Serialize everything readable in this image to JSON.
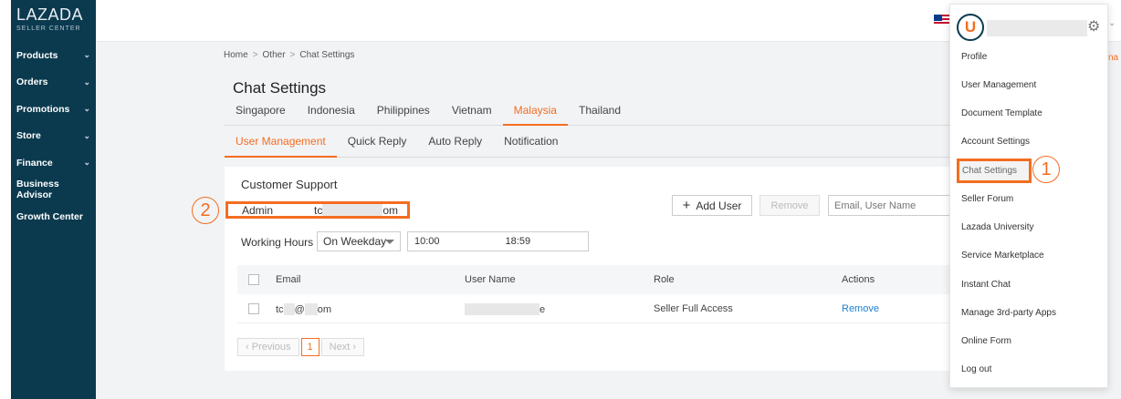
{
  "sidebar": {
    "brand": "LAZADA",
    "brand_sub": "SELLER CENTER",
    "items": [
      {
        "label": "Products",
        "chevron": "⌄"
      },
      {
        "label": "Orders",
        "chevron": "⌄"
      },
      {
        "label": "Promotions",
        "chevron": "⌄"
      },
      {
        "label": "Store",
        "chevron": "⌄"
      },
      {
        "label": "Finance",
        "chevron": "⌄"
      },
      {
        "label": "Business Advisor",
        "chevron": ""
      },
      {
        "label": "Growth Center",
        "chevron": ""
      }
    ]
  },
  "breadcrumb": {
    "home": "Home",
    "sep1": ">",
    "other": "Other",
    "sep2": ">",
    "current": "Chat Settings"
  },
  "page_title": "Chat Settings",
  "country_tabs": [
    "Singapore",
    "Indonesia",
    "Philippines",
    "Vietnam",
    "Malaysia",
    "Thailand"
  ],
  "country_active": "Malaysia",
  "sub_tabs": [
    "User Management",
    "Quick Reply",
    "Auto Reply",
    "Notification"
  ],
  "sub_active": "User Management",
  "card": {
    "title": "Customer Support",
    "admin_label": "Admin",
    "admin_email_start": "tc",
    "admin_email_end": "om",
    "add_user_icon": "+",
    "add_user_label": "Add User",
    "remove_label": "Remove",
    "search_placeholder": "Email, User Name",
    "working_hours_label": "Working Hours",
    "schedule_value": "On Weekday",
    "time_start": "10:00",
    "time_end": "18:59"
  },
  "table": {
    "headers": [
      "Email",
      "User Name",
      "Role",
      "Actions"
    ],
    "row": {
      "email_start": "tc",
      "email_mid": "@",
      "email_end": "om",
      "username_end": "e",
      "role": "Seller Full Access",
      "action": "Remove"
    }
  },
  "pagination": {
    "prev": "Previous",
    "page": "1",
    "next": "Next"
  },
  "markers": {
    "one": "1",
    "two": "2"
  },
  "dropdown": {
    "items": [
      "Profile",
      "User Management",
      "Document Template",
      "Account Settings",
      "Chat Settings",
      "Seller Forum",
      "Lazada University",
      "Service Marketplace",
      "Instant Chat",
      "Manage 3rd-party Apps",
      "Online Form",
      "Log out"
    ],
    "active": "Chat Settings"
  },
  "edge_text": "na",
  "colors": {
    "accent": "#f36d21",
    "sidebar": "#0b3a4f",
    "link": "#1a7fd2"
  },
  "icons": {
    "settings": "gear-icon",
    "avatar": "avatar-logo",
    "flag": "flag-malaysia-icon"
  }
}
